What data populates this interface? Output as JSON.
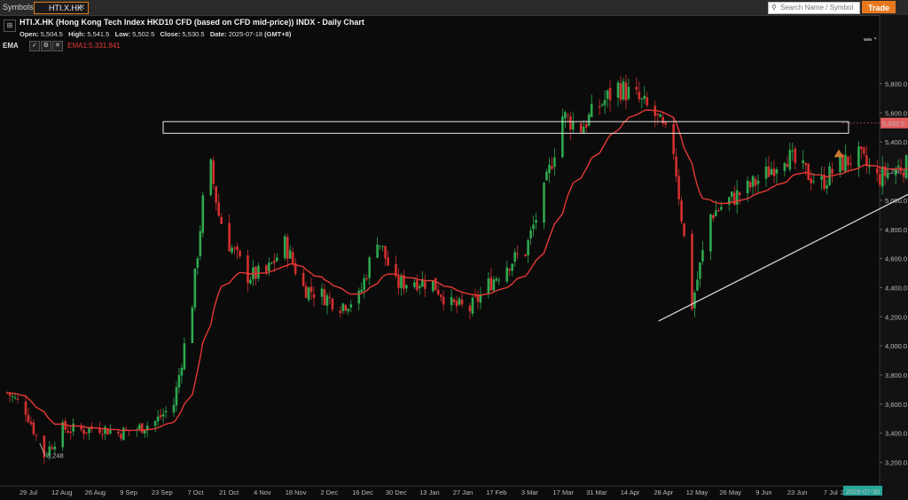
{
  "topbar": {
    "symbols_label": "Symbols:",
    "symbol_tab": "HTI.X.HK",
    "search_placeholder": "Search Name / Symbol",
    "trade_label": "Trade"
  },
  "header": {
    "title": "HTI.X.HK (Hong Kong Tech Index HKD10 CFD (based on CFD mid-price)) INDX - Daily Chart",
    "open_label": "Open:",
    "open": "5,504.5",
    "high_label": "High:",
    "high": "5,541.5",
    "low_label": "Low:",
    "low": "5,502.5",
    "close_label": "Close:",
    "close": "5,530.5",
    "date_label": "Date:",
    "date": "2025-07-18",
    "tz": "(GMT+8)"
  },
  "indicator": {
    "name": "EMA",
    "value_label": "EMA1:5,331.841",
    "color": "#e53935"
  },
  "colors": {
    "up": "#2ea84f",
    "down": "#d32f2f",
    "ema": "#e53935",
    "trade": "#e8781e",
    "price_tag": "#e35d5d",
    "date_tag": "#26a69a"
  },
  "chart_data": {
    "type": "candlestick",
    "y_ticks": [
      3200,
      3400,
      3600,
      3800,
      4000,
      4200,
      4400,
      4600,
      4800,
      5000,
      5200,
      5400,
      5600,
      5800
    ],
    "y_tick_labels": [
      "3,200.0",
      "3,400.0",
      "3,600.0",
      "3,800.0",
      "4,000.0",
      "4,200.0",
      "4,400.0",
      "4,600.0",
      "4,800.0",
      "5,000.0",
      "5,200.0",
      "5,400.0",
      "5,600.0",
      "5,800.0"
    ],
    "x_labels": [
      "29 Jul",
      "12 Aug",
      "26 Aug",
      "9 Sep",
      "23 Sep",
      "7 Oct",
      "21 Oct",
      "4 Nov",
      "18 Nov",
      "2 Dec",
      "16 Dec",
      "30 Dec",
      "13 Jan",
      "27 Jan",
      "17 Feb",
      "3 Mar",
      "17 Mar",
      "31 Mar",
      "14 Apr",
      "28 Apr",
      "12 May",
      "26 May",
      "9 Jun",
      "23 Jun",
      "7 Jul",
      "2"
    ],
    "last_price_label": "5,530.5",
    "last_price": 5530.5,
    "low_marker_label": "3,248",
    "low_marker_value": 3248,
    "cursor_date_label": "2025-07-30",
    "resistance_zone": [
      5460,
      5540
    ],
    "ema_last": 5331.841,
    "path": [
      [
        "2024-07-22",
        3680
      ],
      [
        "2024-07-29",
        3560
      ],
      [
        "2024-08-05",
        3248
      ],
      [
        "2024-08-12",
        3430
      ],
      [
        "2024-08-19",
        3420
      ],
      [
        "2024-08-26",
        3440
      ],
      [
        "2024-09-02",
        3400
      ],
      [
        "2024-09-09",
        3430
      ],
      [
        "2024-09-16",
        3480
      ],
      [
        "2024-09-23",
        3600
      ],
      [
        "2024-09-30",
        4300
      ],
      [
        "2024-10-06",
        5330
      ],
      [
        "2024-10-10",
        4900
      ],
      [
        "2024-10-14",
        4700
      ],
      [
        "2024-10-21",
        4480
      ],
      [
        "2024-10-28",
        4500
      ],
      [
        "2024-11-04",
        4700
      ],
      [
        "2024-11-11",
        4400
      ],
      [
        "2024-11-18",
        4350
      ],
      [
        "2024-11-25",
        4280
      ],
      [
        "2024-12-02",
        4330
      ],
      [
        "2024-12-09",
        4750
      ],
      [
        "2024-12-16",
        4420
      ],
      [
        "2024-12-23",
        4450
      ],
      [
        "2024-12-30",
        4430
      ],
      [
        "2025-01-06",
        4280
      ],
      [
        "2025-01-13",
        4250
      ],
      [
        "2025-01-20",
        4420
      ],
      [
        "2025-01-27",
        4560
      ],
      [
        "2025-02-03",
        4650
      ],
      [
        "2025-02-10",
        5050
      ],
      [
        "2025-02-17",
        5580
      ],
      [
        "2025-02-24",
        5500
      ],
      [
        "2025-03-03",
        5650
      ],
      [
        "2025-03-10",
        5780
      ],
      [
        "2025-03-17",
        5700
      ],
      [
        "2025-03-24",
        5580
      ],
      [
        "2025-03-31",
        5350
      ],
      [
        "2025-04-07",
        4280
      ],
      [
        "2025-04-14",
        4900
      ],
      [
        "2025-04-21",
        5000
      ],
      [
        "2025-04-28",
        5080
      ],
      [
        "2025-05-05",
        5180
      ],
      [
        "2025-05-12",
        5320
      ],
      [
        "2025-05-19",
        5200
      ],
      [
        "2025-05-26",
        5120
      ],
      [
        "2025-06-02",
        5250
      ],
      [
        "2025-06-09",
        5300
      ],
      [
        "2025-06-16",
        5150
      ],
      [
        "2025-06-23",
        5220
      ],
      [
        "2025-06-30",
        5250
      ],
      [
        "2025-07-07",
        5280
      ],
      [
        "2025-07-14",
        5430
      ],
      [
        "2025-07-18",
        5530
      ]
    ],
    "trendline": [
      [
        "2025-04-01",
        4170
      ],
      [
        "2025-07-30",
        5400
      ]
    ]
  }
}
